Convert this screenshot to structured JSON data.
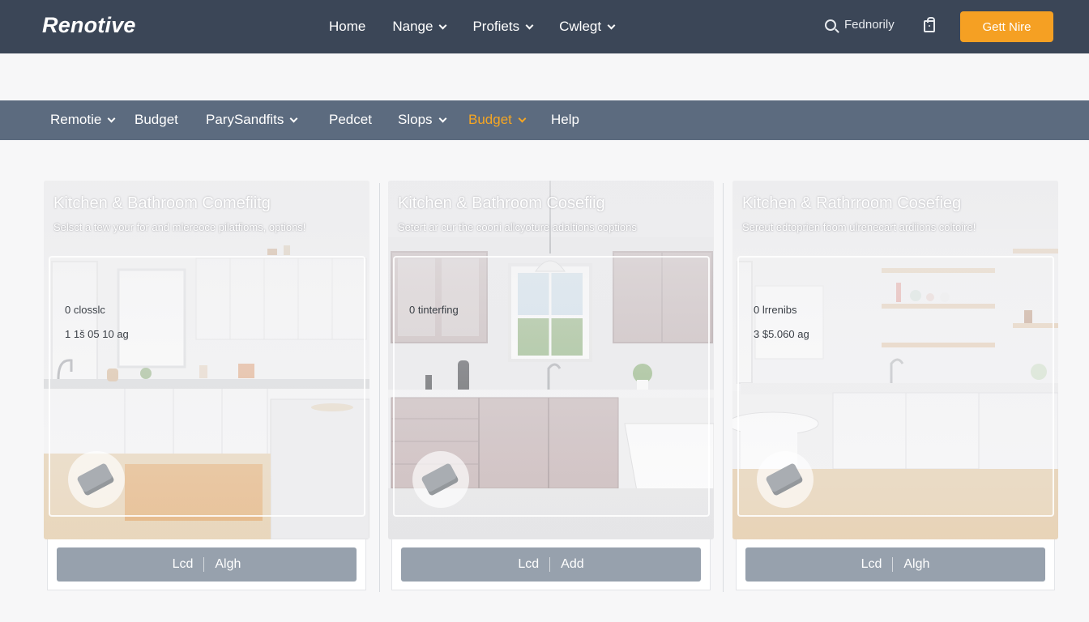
{
  "header": {
    "brand": "Renotive",
    "nav": [
      {
        "label": "Home",
        "dropdown": false
      },
      {
        "label": "Nange",
        "dropdown": true
      },
      {
        "label": "Profiets",
        "dropdown": true
      },
      {
        "label": "Cwlegt",
        "dropdown": true
      }
    ],
    "search_label": "Fednorily",
    "cta_label": "Gett Nire",
    "colors": {
      "bar": "#3b4657",
      "cta": "#f5a023"
    }
  },
  "subnav": {
    "items": [
      {
        "label": "Remotie",
        "dropdown": true,
        "active": false
      },
      {
        "label": "Budget",
        "dropdown": false,
        "active": false
      },
      {
        "label": "ParySandfits",
        "dropdown": true,
        "active": false
      },
      {
        "label": "Pedcet",
        "dropdown": false,
        "active": false
      },
      {
        "label": "Slops",
        "dropdown": true,
        "active": false
      },
      {
        "label": "Budget",
        "dropdown": true,
        "active": true
      },
      {
        "label": "Help",
        "dropdown": false,
        "active": false
      }
    ],
    "colors": {
      "bar": "#5c6b7f",
      "active": "#f5a623"
    }
  },
  "cards": [
    {
      "title": "Kitchen & Bathroom Comefiitg",
      "subtitle": "Selsct a tew your for and mlereoce pilatfioms, options!",
      "line1": "0 closslc",
      "line2": "1 1š 05 10 ag",
      "action_left": "Lcd",
      "action_right": "Algh"
    },
    {
      "title": "Kitchen & Bathroom Cosefiig",
      "subtitle": "Setert ar cur the cooni allcyoture adaltions coptions",
      "line1": "0 tinterfing",
      "line2": "",
      "action_left": "Lcd",
      "action_right": "Add"
    },
    {
      "title": "Kitchen & Rathrroom Cosefieg",
      "subtitle": "Sereut edtoprien foom ulrenecart ardiions coltoire!",
      "line1": "0 lrrenibs",
      "line2": "3 $5.060 ag",
      "action_left": "Lcd",
      "action_right": "Algh"
    }
  ]
}
